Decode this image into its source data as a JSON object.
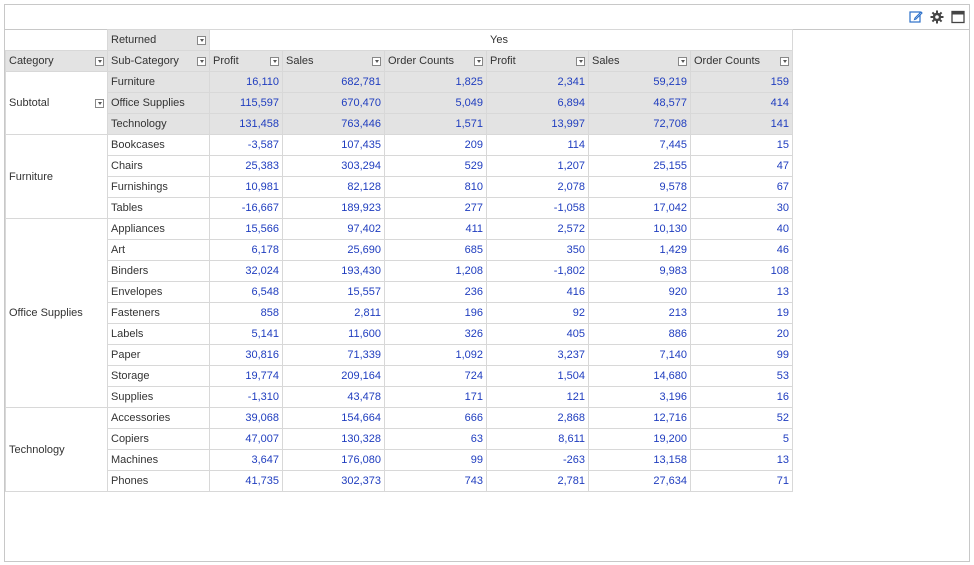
{
  "headers": {
    "returned_label": "Returned",
    "returned_value": "Yes",
    "category": "Category",
    "sub_category": "Sub-Category",
    "measures": [
      "Profit",
      "Sales",
      "Order Counts",
      "Profit",
      "Sales",
      "Order Counts"
    ]
  },
  "subtotal": {
    "label": "Subtotal",
    "rows": [
      {
        "sub": "Furniture",
        "vals": [
          "16,110",
          "682,781",
          "1,825",
          "2,341",
          "59,219",
          "159"
        ]
      },
      {
        "sub": "Office Supplies",
        "vals": [
          "115,597",
          "670,470",
          "5,049",
          "6,894",
          "48,577",
          "414"
        ]
      },
      {
        "sub": "Technology",
        "vals": [
          "131,458",
          "763,446",
          "1,571",
          "13,997",
          "72,708",
          "141"
        ]
      }
    ]
  },
  "groups": [
    {
      "category": "Furniture",
      "rows": [
        {
          "sub": "Bookcases",
          "vals": [
            "-3,587",
            "107,435",
            "209",
            "114",
            "7,445",
            "15"
          ]
        },
        {
          "sub": "Chairs",
          "vals": [
            "25,383",
            "303,294",
            "529",
            "1,207",
            "25,155",
            "47"
          ]
        },
        {
          "sub": "Furnishings",
          "vals": [
            "10,981",
            "82,128",
            "810",
            "2,078",
            "9,578",
            "67"
          ]
        },
        {
          "sub": "Tables",
          "vals": [
            "-16,667",
            "189,923",
            "277",
            "-1,058",
            "17,042",
            "30"
          ]
        }
      ]
    },
    {
      "category": "Office Supplies",
      "rows": [
        {
          "sub": "Appliances",
          "vals": [
            "15,566",
            "97,402",
            "411",
            "2,572",
            "10,130",
            "40"
          ]
        },
        {
          "sub": "Art",
          "vals": [
            "6,178",
            "25,690",
            "685",
            "350",
            "1,429",
            "46"
          ]
        },
        {
          "sub": "Binders",
          "vals": [
            "32,024",
            "193,430",
            "1,208",
            "-1,802",
            "9,983",
            "108"
          ]
        },
        {
          "sub": "Envelopes",
          "vals": [
            "6,548",
            "15,557",
            "236",
            "416",
            "920",
            "13"
          ]
        },
        {
          "sub": "Fasteners",
          "vals": [
            "858",
            "2,811",
            "196",
            "92",
            "213",
            "19"
          ]
        },
        {
          "sub": "Labels",
          "vals": [
            "5,141",
            "11,600",
            "326",
            "405",
            "886",
            "20"
          ]
        },
        {
          "sub": "Paper",
          "vals": [
            "30,816",
            "71,339",
            "1,092",
            "3,237",
            "7,140",
            "99"
          ]
        },
        {
          "sub": "Storage",
          "vals": [
            "19,774",
            "209,164",
            "724",
            "1,504",
            "14,680",
            "53"
          ]
        },
        {
          "sub": "Supplies",
          "vals": [
            "-1,310",
            "43,478",
            "171",
            "121",
            "3,196",
            "16"
          ]
        }
      ]
    },
    {
      "category": "Technology",
      "rows": [
        {
          "sub": "Accessories",
          "vals": [
            "39,068",
            "154,664",
            "666",
            "2,868",
            "12,716",
            "52"
          ]
        },
        {
          "sub": "Copiers",
          "vals": [
            "47,007",
            "130,328",
            "63",
            "8,611",
            "19,200",
            "5"
          ]
        },
        {
          "sub": "Machines",
          "vals": [
            "3,647",
            "176,080",
            "99",
            "-263",
            "13,158",
            "13"
          ]
        },
        {
          "sub": "Phones",
          "vals": [
            "41,735",
            "302,373",
            "743",
            "2,781",
            "27,634",
            "71"
          ]
        }
      ]
    }
  ],
  "icons": {
    "edit": "edit-icon",
    "settings": "gear-icon",
    "maximize": "maximize-icon",
    "filter": "chevron-down-icon"
  },
  "colors": {
    "value_text": "#1f3dbf",
    "header_bg": "#e3e3e3",
    "accent": "#2a6fc9"
  }
}
